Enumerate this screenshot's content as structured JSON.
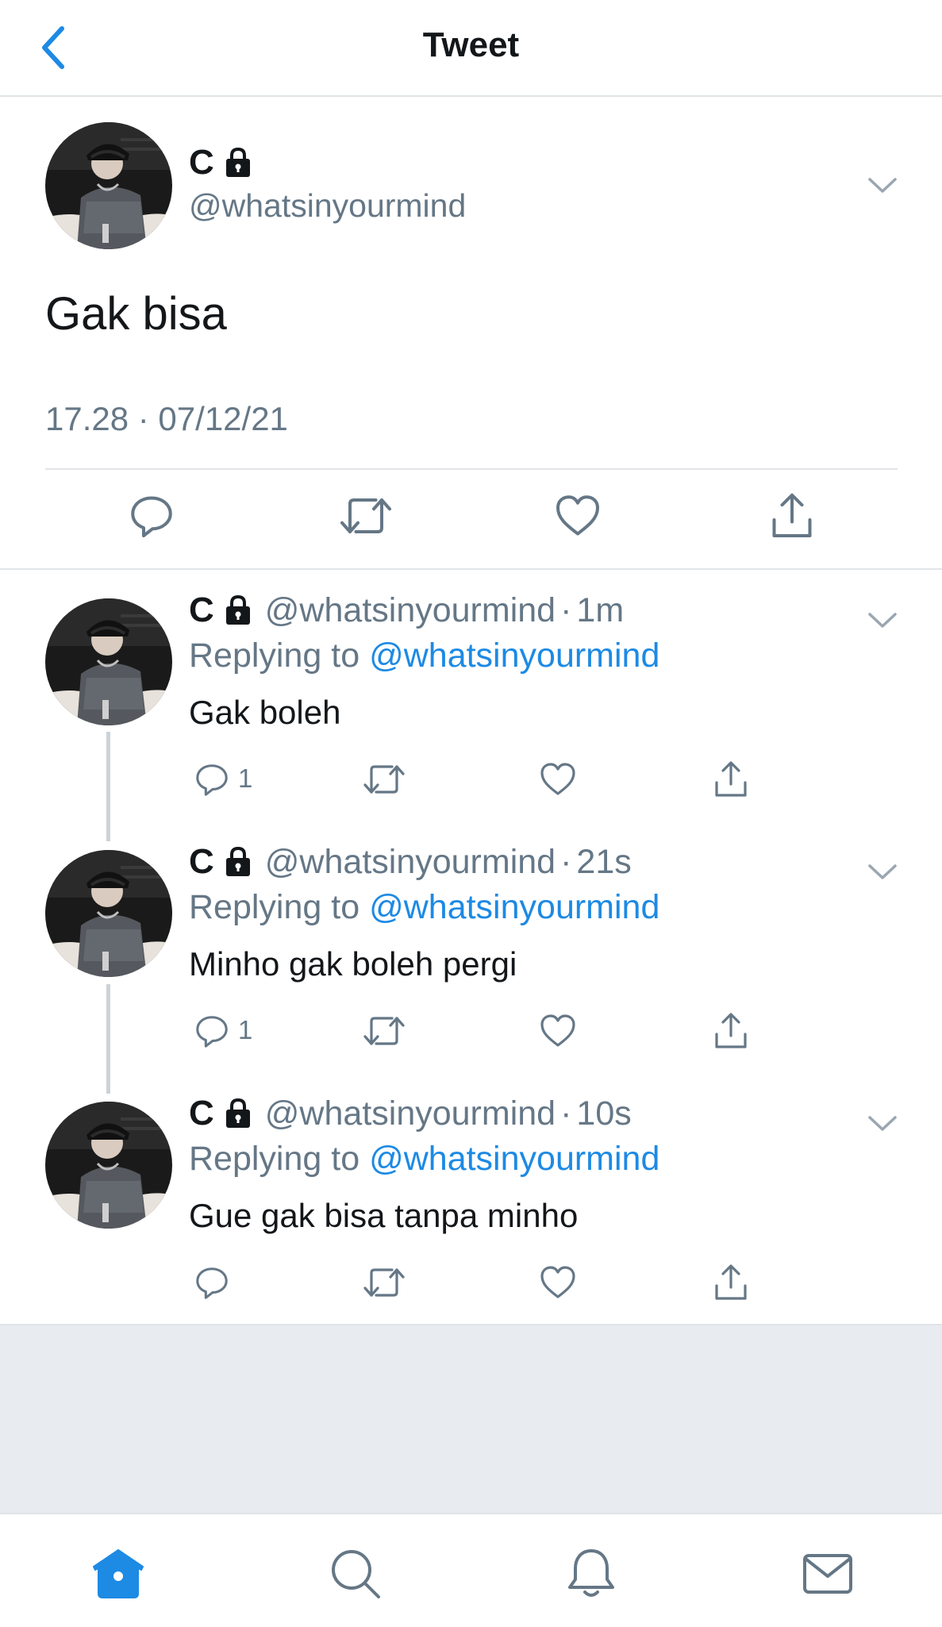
{
  "header": {
    "title": "Tweet",
    "back_icon": "chevron-left-icon"
  },
  "colors": {
    "accent": "#1d8ae4",
    "secondary_text": "#657786",
    "divider": "#e1e4e8",
    "background_grey": "#e8ebef"
  },
  "main_tweet": {
    "name": "C",
    "handle": "@whatsinyourmind",
    "text": "Gak bisa",
    "timestamp": "17.28 · 07/12/21",
    "icons": [
      "reply-icon",
      "retweet-icon",
      "like-icon",
      "share-icon"
    ]
  },
  "replies": [
    {
      "name": "C",
      "handle": "@whatsinyourmind",
      "dot": "·",
      "ago": "1m",
      "replying_prefix": "Replying to ",
      "replying_to": "@whatsinyourmind",
      "text": "Gak boleh",
      "reply_count": "1"
    },
    {
      "name": "C",
      "handle": "@whatsinyourmind",
      "dot": "·",
      "ago": "21s",
      "replying_prefix": "Replying to ",
      "replying_to": "@whatsinyourmind",
      "text": "Minho gak boleh pergi",
      "reply_count": "1"
    },
    {
      "name": "C",
      "handle": "@whatsinyourmind",
      "dot": "·",
      "ago": "10s",
      "replying_prefix": "Replying to ",
      "replying_to": "@whatsinyourmind",
      "text": "Gue gak bisa tanpa minho",
      "reply_count": ""
    }
  ],
  "tabbar": {
    "icons": [
      "home-icon",
      "search-icon",
      "notifications-icon",
      "messages-icon"
    ]
  }
}
